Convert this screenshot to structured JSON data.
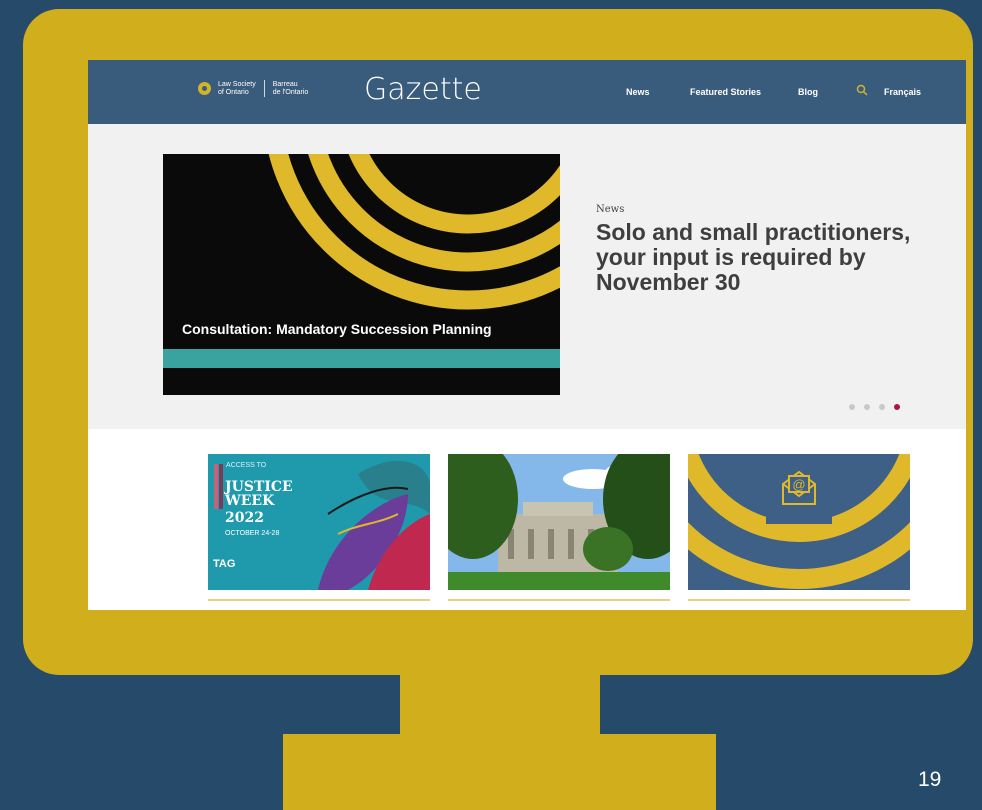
{
  "site": {
    "logo_line1": "Law Society",
    "logo_line2": "of Ontario",
    "logo_fr_line1": "Barreau",
    "logo_fr_line2": "de l'Ontario",
    "title": "Gazette"
  },
  "nav": {
    "items": [
      "News",
      "Featured Stories",
      "Blog"
    ],
    "language": "Français",
    "icon": "search-icon"
  },
  "hero": {
    "image_caption": "Consultation: Mandatory Succession Planning",
    "kicker": "News",
    "headline": "Solo and small practitioners, your input is required by November 30",
    "slide_count": 4,
    "active_slide": 4
  },
  "cards": {
    "justice_week": {
      "small_text_1": "ACCESS TO",
      "title": "JUSTICE",
      "title_2": "WEEK",
      "year": "2022",
      "dates": "OCTOBER 24-28",
      "tag": "TAG"
    },
    "building": {},
    "email": {
      "icon": "email-at-icon"
    }
  },
  "slide_number": "19",
  "colors": {
    "background": "#254a6a",
    "monitor": "#d1ae1b",
    "nav_bar": "#3a5c7c",
    "accent_teal": "#3aa3a0",
    "active_dot": "#a8173f"
  }
}
